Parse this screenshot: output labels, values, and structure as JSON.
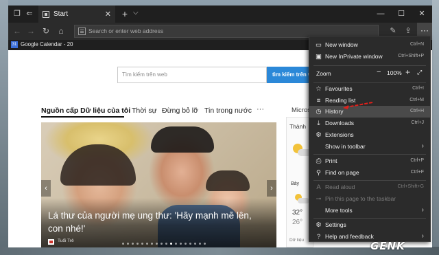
{
  "tab": {
    "title": "Start"
  },
  "address": {
    "placeholder": "Search or enter web address"
  },
  "favorites_bar": {
    "items": [
      {
        "label": "Google Calendar - 20"
      }
    ]
  },
  "page": {
    "search": {
      "placeholder": "Tìm kiếm trên web",
      "button_label": "tìm kiếm trên web"
    },
    "categories": [
      "Nguồn cấp Dữ liệu của tôi",
      "Thời sự",
      "Đừng bỏ lỡ",
      "Tin trong nước"
    ],
    "more_label": "···",
    "micro_label": "Micros",
    "hero": {
      "title": "Lá thư của người mẹ ung thư: 'Hãy mạnh mẽ lên, con nhé!'",
      "source": "Tuổi Trẻ",
      "slide_count": 18,
      "active_slide": 10
    },
    "weather": {
      "title": "Thành",
      "day": "Bảy",
      "high": "32°",
      "low": "26°",
      "footer": "Dữ liệu"
    }
  },
  "menu": {
    "new_window": {
      "label": "New window",
      "shortcut": "Ctrl+N"
    },
    "new_inprivate": {
      "label": "New InPrivate window",
      "shortcut": "Ctrl+Shift+P"
    },
    "zoom": {
      "label": "Zoom",
      "value": "100%"
    },
    "favourites": {
      "label": "Favourites",
      "shortcut": "Ctrl+I"
    },
    "reading_list": {
      "label": "Reading list",
      "shortcut": "Ctrl+M"
    },
    "history": {
      "label": "History",
      "shortcut": "Ctrl+H"
    },
    "downloads": {
      "label": "Downloads",
      "shortcut": "Ctrl+J"
    },
    "extensions": {
      "label": "Extensions"
    },
    "show_in_toolbar": {
      "label": "Show in toolbar"
    },
    "print": {
      "label": "Print",
      "shortcut": "Ctrl+P"
    },
    "find_on_page": {
      "label": "Find on page",
      "shortcut": "Ctrl+F"
    },
    "read_aloud": {
      "label": "Read aloud",
      "shortcut": "Ctrl+Shift+G"
    },
    "pin_taskbar": {
      "label": "Pin this page to the taskbar"
    },
    "more_tools": {
      "label": "More tools"
    },
    "settings": {
      "label": "Settings"
    },
    "help": {
      "label": "Help and feedback"
    }
  },
  "watermark": {
    "text": "GENK"
  },
  "colors": {
    "accent": "#2b88d8",
    "annotation": "#e0201b",
    "menu_bg": "#2b2b2b"
  }
}
